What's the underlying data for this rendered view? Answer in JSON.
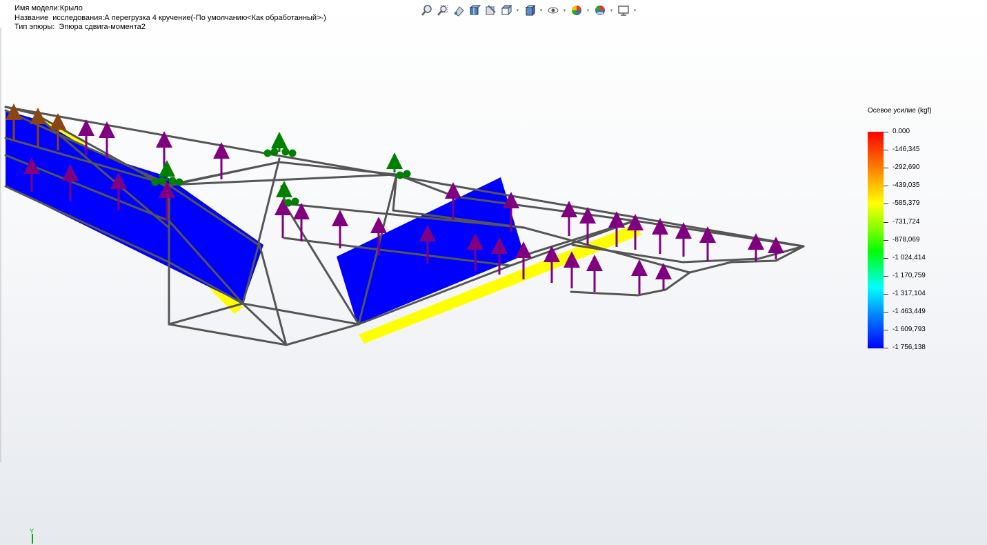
{
  "info": {
    "model_label": "Имя модели:",
    "model_value": "Крыло",
    "study_label": "Название  исследования:",
    "study_value": "А перегрузка 4 кручение(-По умолчанию<Как обработанный>-)",
    "plot_label": "Тип эпюры:  ",
    "plot_value": "Эпюра сдвига-момента2"
  },
  "toolbar": {
    "icons": [
      "zoom-to-fit-icon",
      "zoom-area-icon",
      "previous-view-icon",
      "section-view-icon",
      "dynamic-annotation-icon",
      "view-orientation-icon",
      "display-style-icon",
      "hide-show-icon",
      "edit-appearance-icon",
      "apply-scene-icon",
      "view-settings-icon"
    ]
  },
  "legend": {
    "title": "Осевое усилие (kgf)",
    "values": [
      "0.000",
      "-146,345",
      "-292,690",
      "-439,035",
      "-585,379",
      "-731,724",
      "-878,069",
      "-1 024,414",
      "-1 170,759",
      "-1 317,104",
      "-1 463,449",
      "-1 609,793",
      "-1 756,138"
    ],
    "colors": [
      "#ff0000",
      "#ff6a00",
      "#ffb000",
      "#ffff00",
      "#c0ff00",
      "#60ff00",
      "#00ff00",
      "#00ff90",
      "#00ffff",
      "#00b0ff",
      "#0060ff",
      "#0020ff",
      "#0000ff"
    ]
  },
  "triad": {
    "axis_y": "Y"
  },
  "colors": {
    "beam": "#555555",
    "force_arrow": "#800080",
    "fixture": "#008000",
    "remote_load": "#8b4513",
    "diagram_blue": "#0000ff",
    "diagram_yellow": "#ffff00"
  }
}
